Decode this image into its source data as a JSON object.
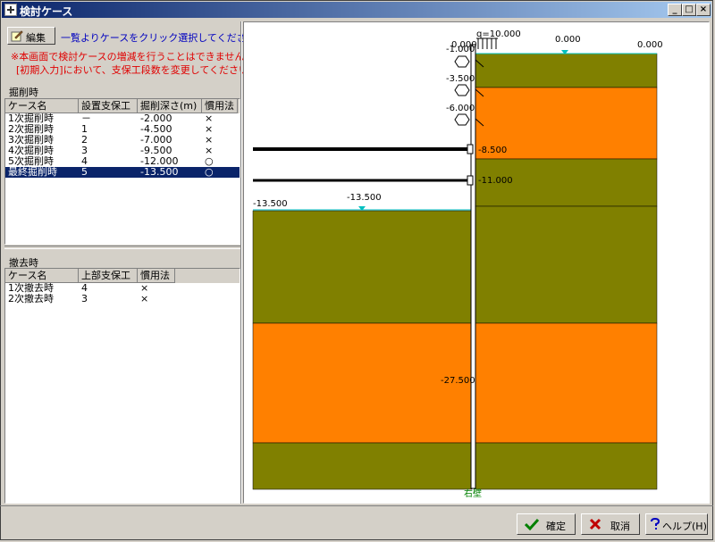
{
  "window": {
    "title": "検討ケース"
  },
  "toolbar": {
    "edit_label": "編集",
    "hint": "一覧よりケースをクリック選択してください",
    "warning_line1": "※本画面で検討ケースの増減を行うことはできません。",
    "warning_line2": "[初期入力]において、支保工段数を変更してください。"
  },
  "excavation": {
    "section_label": "掘削時",
    "columns": [
      "ケース名",
      "設置支保工",
      "掘削深さ(m)",
      "慣用法"
    ],
    "rows": [
      [
        "1次掘削時",
        "－",
        "-2.000",
        "×"
      ],
      [
        "2次掘削時",
        "1",
        "-4.500",
        "×"
      ],
      [
        "3次掘削時",
        "2",
        "-7.000",
        "×"
      ],
      [
        "4次掘削時",
        "3",
        "-9.500",
        "×"
      ],
      [
        "5次掘削時",
        "4",
        "-12.000",
        "○"
      ],
      [
        "最終掘削時",
        "5",
        "-13.500",
        "○"
      ]
    ],
    "selected_index": 5
  },
  "removal": {
    "section_label": "撤去時",
    "columns": [
      "ケース名",
      "上部支保工",
      "慣用法"
    ],
    "rows": [
      [
        "1次撤去時",
        "4",
        "×"
      ],
      [
        "2次撤去時",
        "3",
        "×"
      ]
    ]
  },
  "diagram": {
    "surcharge_label": "q=10.000",
    "levels": {
      "top_left": "0.000",
      "top_mid": "0.000",
      "top_right": "0.000",
      "s1": "-1.000",
      "s2": "-3.500",
      "s3": "-6.000",
      "s4": "-8.500",
      "s5": "-11.000",
      "excav_left": "-13.500",
      "excav_mid": "-13.500",
      "wall_bottom": "-27.500"
    },
    "wall_label": "右壁",
    "colors": {
      "olive": "#808000",
      "orange": "#ff8000",
      "water": "#00c0c0",
      "wall_label": "#008000"
    }
  },
  "buttons": {
    "ok": "確定",
    "cancel": "取消",
    "help": "ヘルプ(H)"
  }
}
